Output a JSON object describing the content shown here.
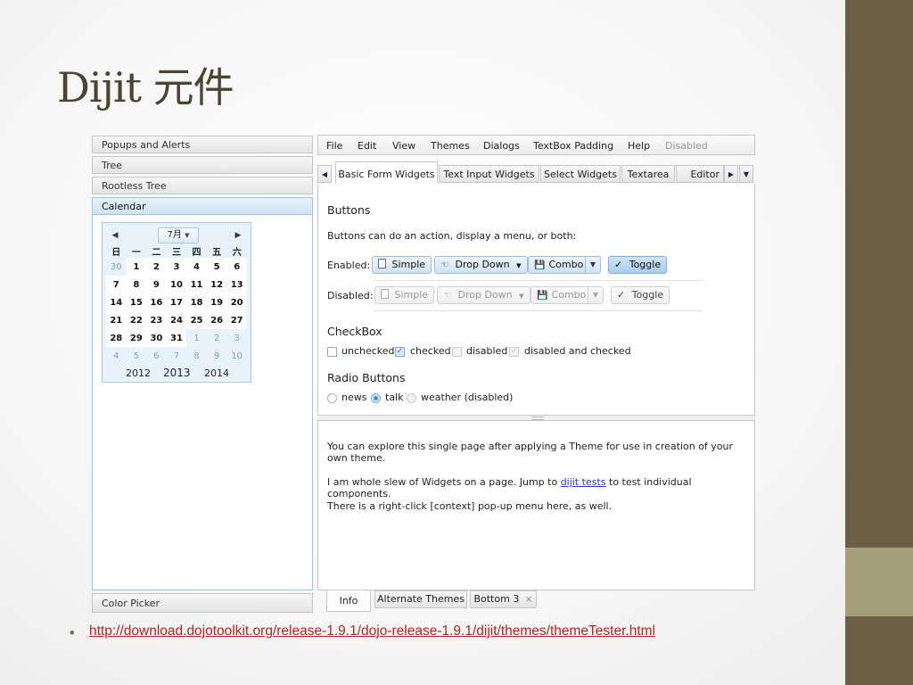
{
  "slide": {
    "title": "Dijit 元件",
    "url": "http://download.dojotoolkit.org/release-1.9.1/dojo-release-1.9.1/dijit/themes/themeTester.html",
    "bullet": "•"
  },
  "accordion": {
    "headers": [
      "Popups and Alerts",
      "Tree",
      "Rootless Tree",
      "Calendar"
    ],
    "bottom": "Color Picker"
  },
  "calendar": {
    "month": "7月",
    "month_arrow": "▼",
    "prev": "◀",
    "next": "▶",
    "weekdays": [
      "日",
      "一",
      "二",
      "三",
      "四",
      "五",
      "六"
    ],
    "weeks": [
      [
        {
          "d": "30",
          "o": true
        },
        {
          "d": "1"
        },
        {
          "d": "2"
        },
        {
          "d": "3"
        },
        {
          "d": "4"
        },
        {
          "d": "5"
        },
        {
          "d": "6"
        }
      ],
      [
        {
          "d": "7"
        },
        {
          "d": "8"
        },
        {
          "d": "9"
        },
        {
          "d": "10"
        },
        {
          "d": "11"
        },
        {
          "d": "12"
        },
        {
          "d": "13"
        }
      ],
      [
        {
          "d": "14"
        },
        {
          "d": "15"
        },
        {
          "d": "16"
        },
        {
          "d": "17"
        },
        {
          "d": "18"
        },
        {
          "d": "19"
        },
        {
          "d": "20"
        }
      ],
      [
        {
          "d": "21"
        },
        {
          "d": "22"
        },
        {
          "d": "23"
        },
        {
          "d": "24"
        },
        {
          "d": "25"
        },
        {
          "d": "26"
        },
        {
          "d": "27"
        }
      ],
      [
        {
          "d": "28"
        },
        {
          "d": "29"
        },
        {
          "d": "30"
        },
        {
          "d": "31"
        },
        {
          "d": "1",
          "o": true
        },
        {
          "d": "2",
          "o": true
        },
        {
          "d": "3",
          "o": true
        }
      ],
      [
        {
          "d": "4",
          "o": true
        },
        {
          "d": "5",
          "o": true
        },
        {
          "d": "6",
          "o": true
        },
        {
          "d": "7",
          "o": true
        },
        {
          "d": "8",
          "o": true
        },
        {
          "d": "9",
          "o": true
        },
        {
          "d": "10",
          "o": true
        }
      ]
    ],
    "years": {
      "prev": "2012",
      "current": "2013",
      "next": "2014"
    }
  },
  "menubar": [
    "File",
    "Edit",
    "View",
    "Themes",
    "Dialogs",
    "TextBox Padding",
    "Help",
    "Disabled"
  ],
  "tabs": [
    "Basic Form Widgets",
    "Text Input Widgets",
    "Select Widgets",
    "Textarea",
    "Editor"
  ],
  "tab_controls": {
    "left": "◀",
    "right": "▶",
    "menu": "▼"
  },
  "buttons_section": {
    "title": "Buttons",
    "desc": "Buttons can do an action, display a menu, or both:",
    "enabled_label": "Enabled:",
    "disabled_label": "Disabled:",
    "simple": "Simple",
    "dropdown": "Drop Down",
    "combo": "Combo",
    "toggle": "Toggle",
    "arrow": "▼",
    "check_mark": "✓"
  },
  "checkbox_section": {
    "title": "CheckBox",
    "items": [
      "unchecked",
      "checked",
      "disabled",
      "disabled and checked"
    ],
    "mark": "✓"
  },
  "radio_section": {
    "title": "Radio Buttons",
    "items": [
      "news",
      "talk",
      "weather (disabled)"
    ]
  },
  "info": {
    "line1": "You can explore this single page after applying a Theme for use in creation of your own theme.",
    "line2_pre": "I am whole slew of Widgets on a page. Jump to ",
    "line2_link": "dijit tests",
    "line2_post": " to test individual components.",
    "line3": "There is a right-click [context] pop-up menu here, as well."
  },
  "bottom_tabs": [
    "Info",
    "Alternate Themes",
    "Bottom 3"
  ],
  "close_glyph": "×",
  "colors": {
    "strip": "#6a5f45",
    "accent": "#a59f79",
    "title": "#4a4432",
    "link": "#b3261e"
  }
}
